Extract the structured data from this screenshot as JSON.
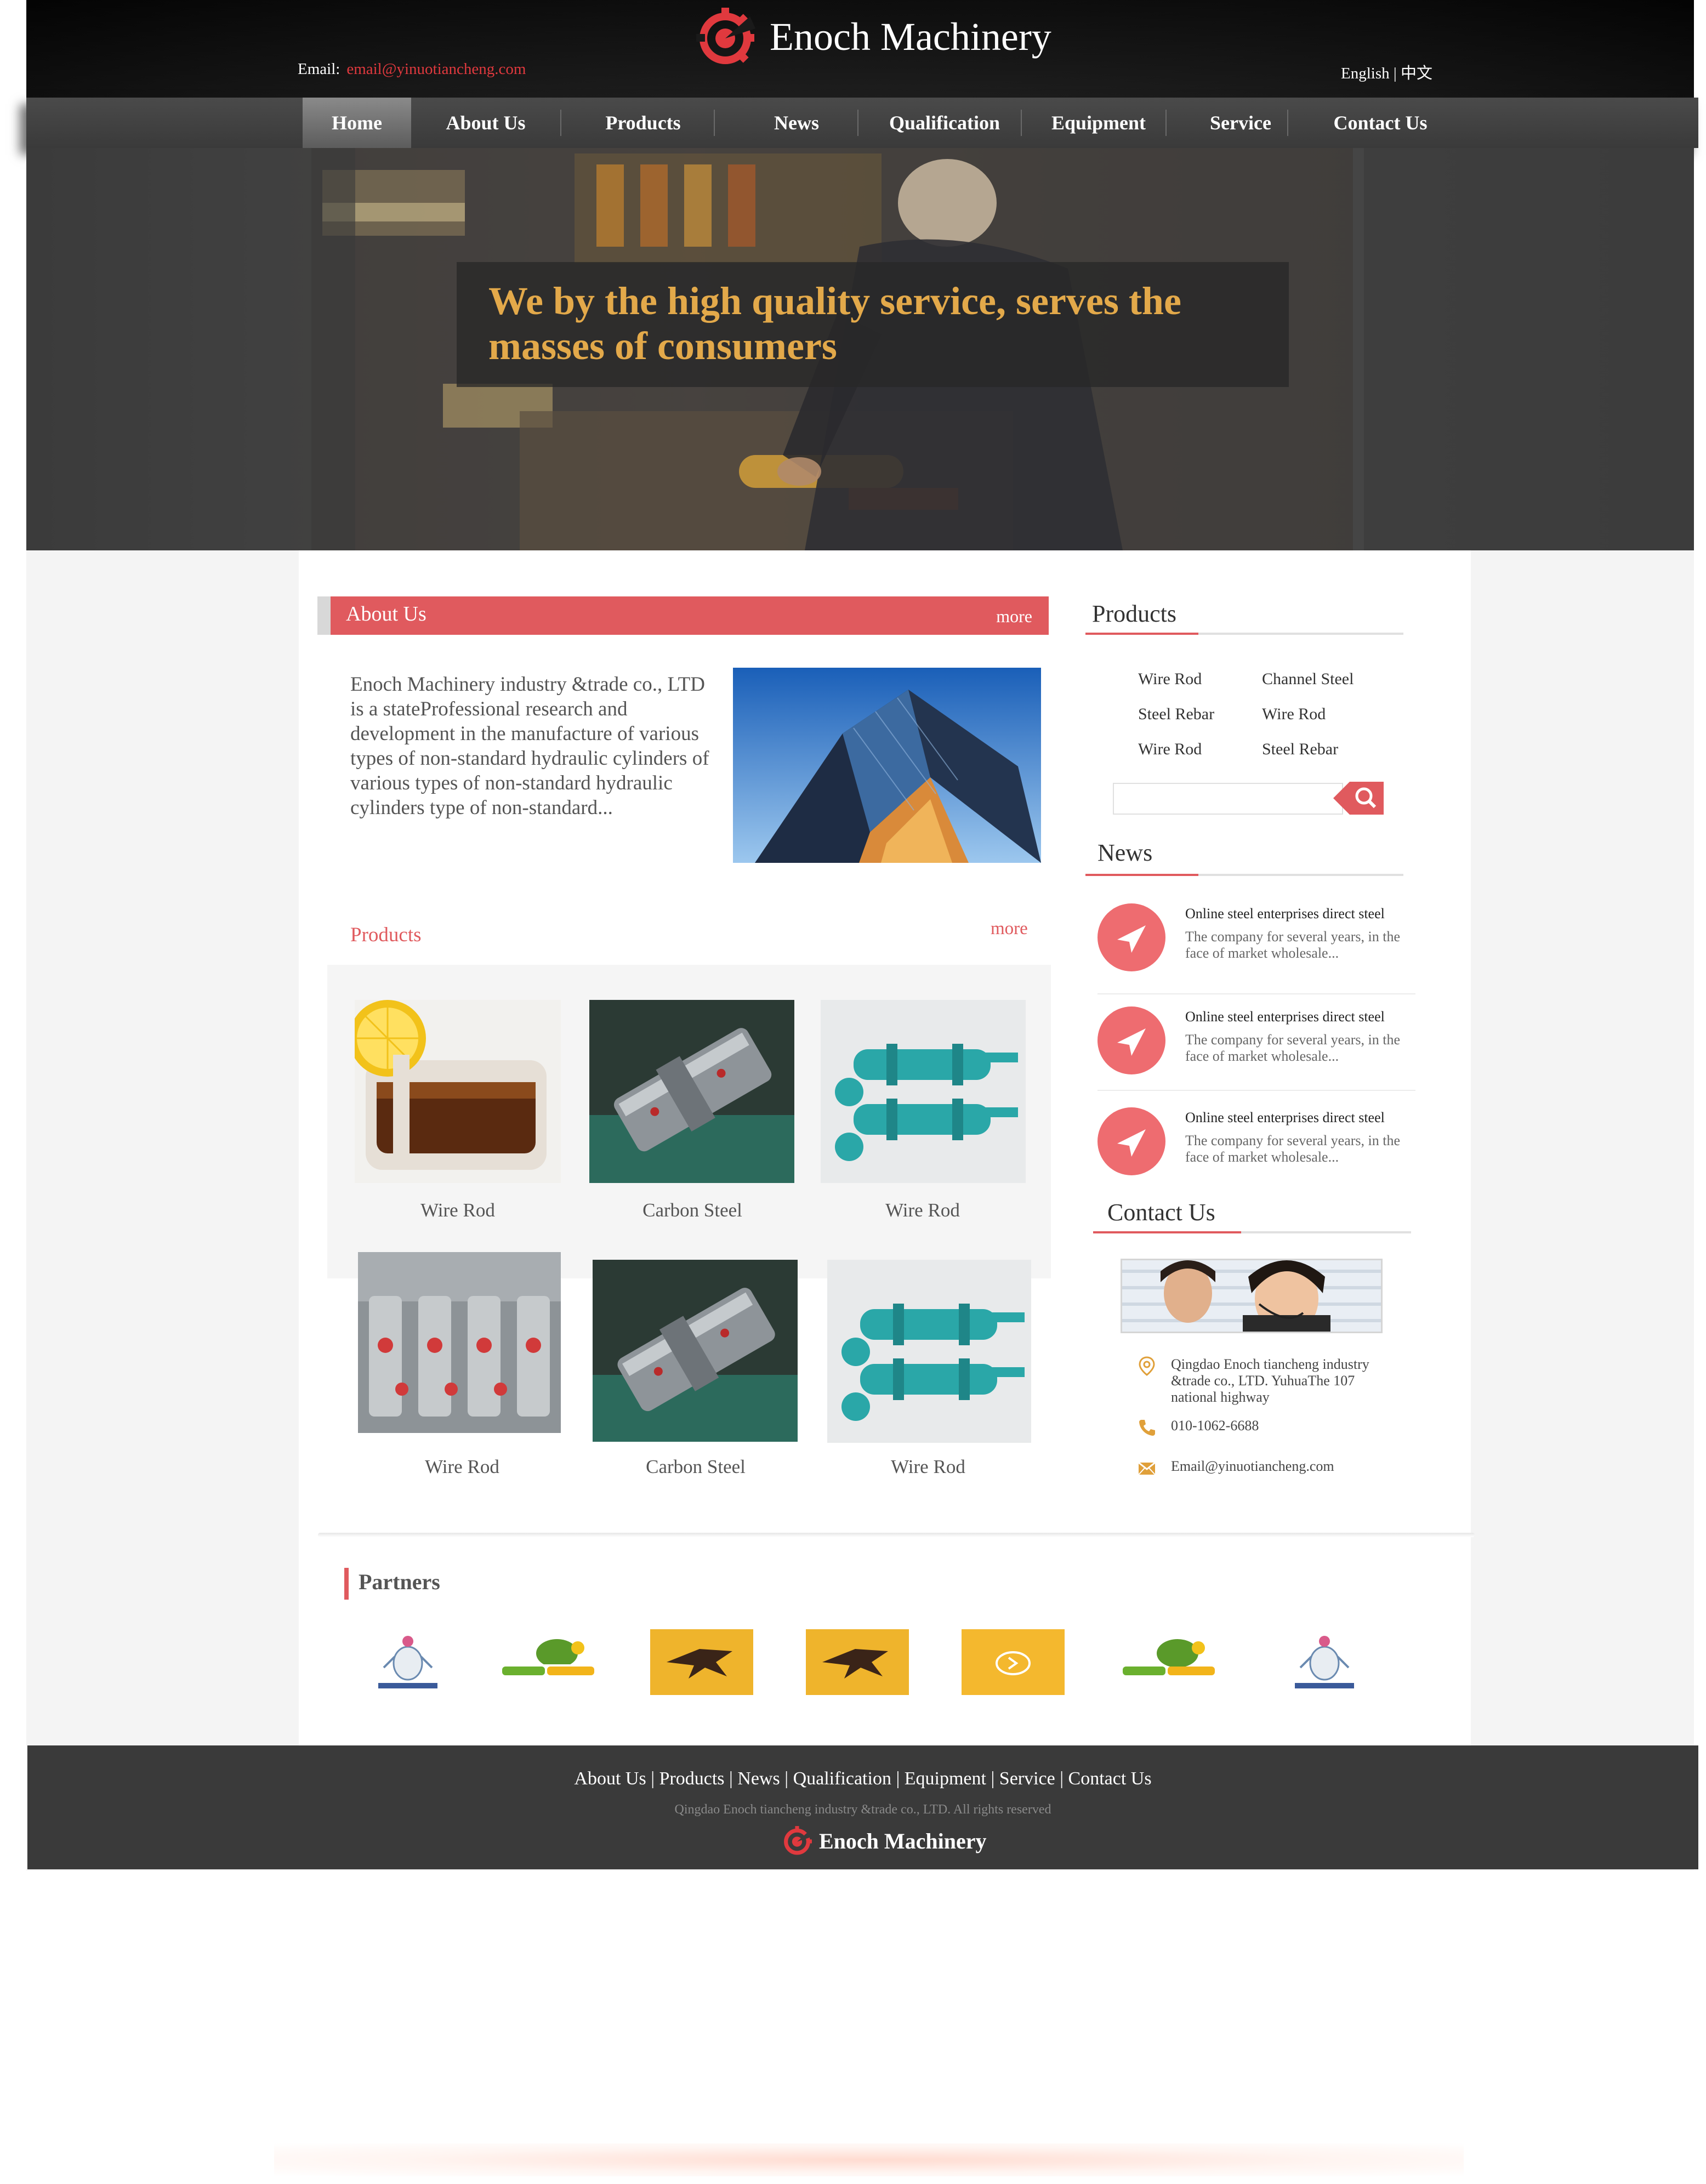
{
  "header": {
    "brand": "Enoch Machinery",
    "email_label": "Email:",
    "email_value": "email@yinuotiancheng.com",
    "lang_en": "English",
    "lang_sep": "|",
    "lang_zh": "中文"
  },
  "nav": {
    "items": [
      {
        "label": "Home",
        "active": true
      },
      {
        "label": "About Us"
      },
      {
        "label": "Products"
      },
      {
        "label": "News"
      },
      {
        "label": "Qualification"
      },
      {
        "label": "Equipment"
      },
      {
        "label": "Service"
      },
      {
        "label": "Contact Us"
      }
    ]
  },
  "banner": {
    "headline": "We by the high quality service, serves the masses of consumers"
  },
  "about": {
    "title": "About Us",
    "more": "more",
    "text": "Enoch Machinery industry &trade co., LTD is a stateProfessional research and development in the manufacture of various types of non-standard hydraulic cylinders  of various types of non-standard hydraulic cylinders  type  of non-standard..."
  },
  "products": {
    "title": "Products",
    "more": "more",
    "items": [
      {
        "label": "Wire Rod"
      },
      {
        "label": "Carbon Steel"
      },
      {
        "label": "Wire Rod"
      },
      {
        "label": "Wire Rod"
      },
      {
        "label": "Carbon Steel"
      },
      {
        "label": "Wire Rod"
      }
    ]
  },
  "sidebar": {
    "products_title": "Products",
    "product_links": [
      "Wire Rod",
      "Channel Steel",
      "Steel Rebar",
      "Wire Rod",
      "Wire Rod",
      "Steel Rebar"
    ],
    "news_title": "News",
    "news": [
      {
        "title": "Online steel enterprises direct steel",
        "desc": "The company for several years, in the face of market wholesale..."
      },
      {
        "title": "Online steel enterprises direct steel",
        "desc": "The company for several years, in the face of market wholesale..."
      },
      {
        "title": "Online steel enterprises direct steel",
        "desc": "The company for several years, in the face of market wholesale..."
      }
    ],
    "contact_title": "Contact Us",
    "address": "Qingdao Enoch tiancheng industry &trade co., LTD. YuhuaThe 107 national highway",
    "phone": "010-1062-6688",
    "email": "Email@yinuotiancheng.com"
  },
  "partners": {
    "title": "Partners"
  },
  "footer": {
    "links": [
      "About Us",
      "Products",
      "News",
      "Qualification",
      "Equipment",
      "Service",
      "Contact Us"
    ],
    "copyright": "Qingdao Enoch tiancheng industry &trade co., LTD. All rights reserved",
    "brand": "Enoch Machinery"
  },
  "colors": {
    "accent": "#e05a5e",
    "banner_text": "#e3a94a",
    "nav_bg": "#3a3a3a",
    "footer_bg": "#3a3a3a"
  },
  "icons": {
    "logo": "gear-logo-icon",
    "search": "search-icon",
    "news": "send-arrow-icon",
    "address": "location-pin-icon",
    "phone": "phone-icon",
    "email": "mail-icon"
  }
}
